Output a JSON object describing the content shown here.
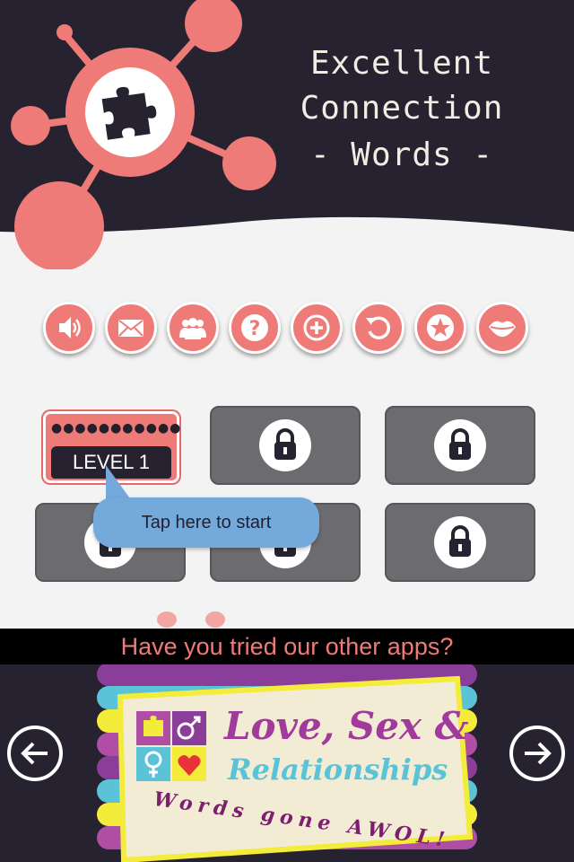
{
  "header": {
    "title_line1": "Excellent",
    "title_line2": "Connection",
    "title_line3": "- Words -",
    "logo_icon": "puzzle-piece-icon"
  },
  "toolbar": {
    "buttons": [
      {
        "name": "sound-icon"
      },
      {
        "name": "mail-icon"
      },
      {
        "name": "people-icon"
      },
      {
        "name": "help-icon"
      },
      {
        "name": "plus-icon"
      },
      {
        "name": "reset-icon"
      },
      {
        "name": "star-icon"
      },
      {
        "name": "lips-icon"
      }
    ]
  },
  "levels": {
    "level1_label": "LEVEL 1",
    "level1_dots": "●●●●●●●●●●●",
    "locked_icon": "lock-icon"
  },
  "tooltip": {
    "text": "Tap here to start"
  },
  "promo": {
    "headline": "Have you tried our other apps?",
    "app_title_line1": "Love, Sex &",
    "app_title_line2": "Relationships",
    "app_tagline": "Words gone AWOL!"
  },
  "colors": {
    "header_bg": "#262230",
    "accent": "#ef7b78",
    "tile_locked": "#6c6c70",
    "bubble": "#74a9dc"
  }
}
